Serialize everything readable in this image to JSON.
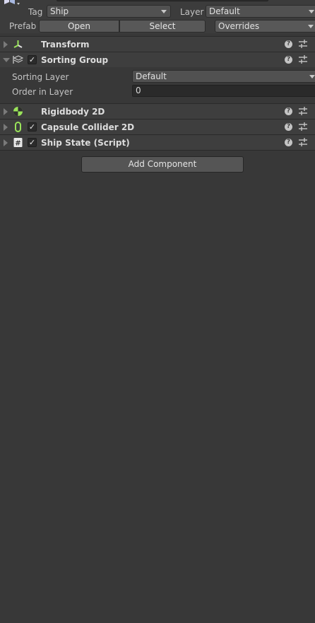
{
  "header": {
    "tag_label": "Tag",
    "tag_value": "Ship",
    "layer_label": "Layer",
    "layer_value": "Default",
    "prefab_label": "Prefab",
    "open_label": "Open",
    "select_label": "Select",
    "overrides_label": "Overrides"
  },
  "components": [
    {
      "title": "Transform",
      "icon": "transform-icon",
      "has_checkbox": false,
      "expanded": false
    },
    {
      "title": "Sorting Group",
      "icon": "sorting-group-icon",
      "has_checkbox": true,
      "expanded": true
    },
    {
      "title": "Rigidbody 2D",
      "icon": "rigidbody-icon",
      "has_checkbox": false,
      "expanded": false
    },
    {
      "title": "Capsule Collider 2D",
      "icon": "capsule-collider-icon",
      "has_checkbox": true,
      "expanded": false
    },
    {
      "title": "Ship State (Script)",
      "icon": "script-icon",
      "has_checkbox": true,
      "expanded": false
    }
  ],
  "sorting_group": {
    "sorting_layer_label": "Sorting Layer",
    "sorting_layer_value": "Default",
    "order_label": "Order in Layer",
    "order_value": "0"
  },
  "add_component_label": "Add Component",
  "colors": {
    "background": "#383838",
    "component_header": "#3e3e3e",
    "accent_green": "#9ae35a"
  }
}
